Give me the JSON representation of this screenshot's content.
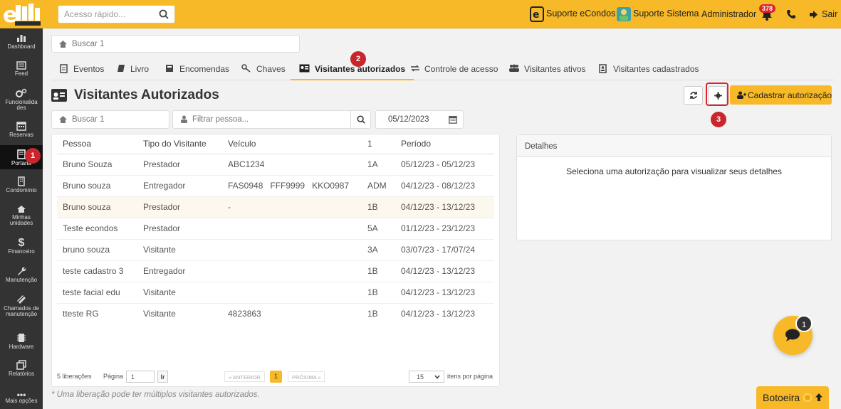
{
  "topbar": {
    "quick_placeholder": "Acesso rápido...",
    "support_econdos": "Suporte eCondos",
    "support_system": "Suporte Sistema",
    "user": "Administrador",
    "notif_count": "378",
    "logout": "Sair"
  },
  "sidebar": {
    "items": [
      {
        "label": "Dashboard",
        "icon": "dashboard-icon"
      },
      {
        "label": "Feed",
        "icon": "feed-icon"
      },
      {
        "label": "Funcionalida des",
        "icon": "features-icon"
      },
      {
        "label": "Reservas",
        "icon": "calendar-icon"
      },
      {
        "label": "Portaria",
        "icon": "portaria-icon",
        "active": true
      },
      {
        "label": "Condomínio",
        "icon": "building-icon"
      },
      {
        "label": "Minhas unidades",
        "icon": "home-icon"
      },
      {
        "label": "Financeiro",
        "icon": "dollar-icon"
      },
      {
        "label": "Manutenção",
        "icon": "wrench-icon"
      },
      {
        "label": "Chamados de manutenção",
        "icon": "ticket-icon"
      },
      {
        "label": "Hardware",
        "icon": "chip-icon"
      },
      {
        "label": "Relatórios",
        "icon": "report-icon"
      },
      {
        "label": "Mais opções",
        "icon": "more-icon"
      }
    ],
    "step_marker": "1"
  },
  "search_top": "Buscar 1",
  "tabs": [
    {
      "label": "Eventos",
      "icon": "events-icon"
    },
    {
      "label": "Livro",
      "icon": "book-icon"
    },
    {
      "label": "Encomendas",
      "icon": "package-icon"
    },
    {
      "label": "Chaves",
      "icon": "key-icon"
    },
    {
      "label": "Visitantes autorizados",
      "icon": "id-card-icon",
      "active": true
    },
    {
      "label": "Controle de acesso",
      "icon": "exchange-icon"
    },
    {
      "label": "Visitantes ativos",
      "icon": "users-icon"
    },
    {
      "label": "Visitantes cadastrados",
      "icon": "badge-icon"
    }
  ],
  "step_2": "2",
  "step_3": "3",
  "page": {
    "title": "Visitantes Autorizados",
    "cadastrar": "Cadastrar autorização"
  },
  "filters": {
    "buscar": "Buscar 1",
    "pessoa_placeholder": "Filtrar pessoa...",
    "date": "05/12/2023"
  },
  "table": {
    "headers": [
      "Pessoa",
      "Tipo do Visitante",
      "Veículo",
      "1",
      "Período"
    ],
    "rows": [
      {
        "pessoa": "Bruno Souza",
        "tipo": "Prestador",
        "veiculo": [
          "ABC1234"
        ],
        "unit": "1A",
        "periodo": "05/12/23 - 05/12/23"
      },
      {
        "pessoa": "Bruno souza",
        "tipo": "Entregador",
        "veiculo": [
          "FAS0948",
          "FFF9999",
          "KKO0987"
        ],
        "unit": "ADM",
        "periodo": "04/12/23 - 08/12/23"
      },
      {
        "pessoa": "Bruno souza",
        "tipo": "Prestador",
        "veiculo": [
          "-"
        ],
        "unit": "1B",
        "periodo": "04/12/23 - 13/12/23"
      },
      {
        "pessoa": "Teste econdos",
        "tipo": "Prestador",
        "veiculo": [],
        "unit": "5A",
        "periodo": "01/12/23 - 23/12/23"
      },
      {
        "pessoa": "bruno souza",
        "tipo": "Visitante",
        "veiculo": [],
        "unit": "3A",
        "periodo": "03/07/23 - 17/07/24"
      },
      {
        "pessoa": "teste cadastro 3",
        "tipo": "Entregador",
        "veiculo": [],
        "unit": "1B",
        "periodo": "04/12/23 - 13/12/23"
      },
      {
        "pessoa": "teste facial edu",
        "tipo": "Visitante",
        "veiculo": [],
        "unit": "1B",
        "periodo": "04/12/23 - 13/12/23"
      },
      {
        "pessoa": "tteste RG",
        "tipo": "Visitante",
        "veiculo": [
          "4823863"
        ],
        "unit": "1B",
        "periodo": "04/12/23 - 13/12/23"
      }
    ]
  },
  "footer": {
    "count": "5 liberações",
    "page_label": "Página",
    "page_value": "1",
    "go": "Ir",
    "prev": "« ANTERIOR",
    "current": "1",
    "next": "PRÓXIMA »",
    "per_page": "15",
    "per_page_label": "itens por página"
  },
  "note": "* Uma liberação pode ter múltiplos visitantes autorizados.",
  "details": {
    "title": "Detalhes",
    "empty": "Seleciona uma autorização para visualizar seus detalhes"
  },
  "chat_badge": "1",
  "botoeira": "Botoeira",
  "colors": {
    "accent": "#f7b928",
    "sidebar": "#333333",
    "danger": "#d9262b"
  }
}
